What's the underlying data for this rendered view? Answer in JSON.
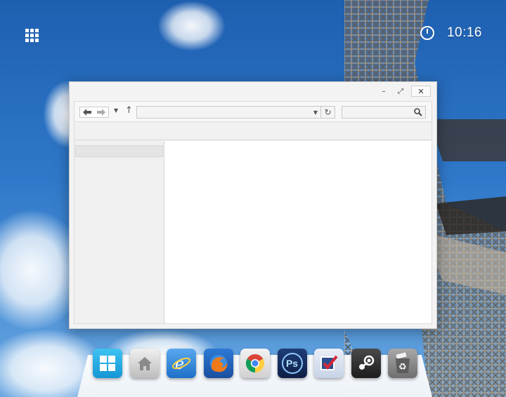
{
  "desktop": {
    "clock_time": "10:16"
  },
  "window": {
    "controls": {
      "minimize": "–",
      "maximize": "⤢",
      "close": "✕"
    },
    "nav": {
      "back_glyph": "🡐",
      "forward_glyph": "🡒",
      "history_glyph": "▼",
      "up_glyph": "↑",
      "address_value": "",
      "address_dropdown_glyph": "▼",
      "refresh_glyph": "↻",
      "search_value": ""
    }
  },
  "dock": {
    "items": [
      {
        "name": "windows-start",
        "icon": "windows-logo-icon",
        "color": "#1ba6e0"
      },
      {
        "name": "home-folder",
        "icon": "house-icon",
        "color": "#cfcfcf"
      },
      {
        "name": "internet-explorer",
        "icon": "ie-logo-icon",
        "color": "#2d7ed9"
      },
      {
        "name": "firefox",
        "icon": "firefox-logo-icon",
        "color": "#e8641c"
      },
      {
        "name": "chrome",
        "icon": "chrome-logo-icon",
        "color": "#4a90d9"
      },
      {
        "name": "photoshop",
        "icon": "photoshop-logo-icon",
        "color": "#142d5c"
      },
      {
        "name": "checklist-app",
        "icon": "checkbox-check-icon",
        "color": "#2a4f8f"
      },
      {
        "name": "steam",
        "icon": "steam-logo-icon",
        "color": "#2a2a2a"
      },
      {
        "name": "recycle-bin",
        "icon": "recycle-bin-icon",
        "color": "#8a8a8a"
      }
    ],
    "photoshop_label": "Ps"
  }
}
